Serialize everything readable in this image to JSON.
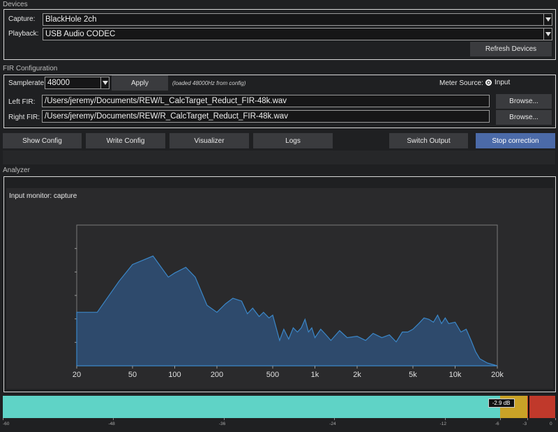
{
  "devices": {
    "title": "Devices",
    "capture_label": "Capture:",
    "capture_value": "BlackHole 2ch",
    "playback_label": "Playback:",
    "playback_value": "USB Audio CODEC",
    "refresh_label": "Refresh Devices"
  },
  "fir": {
    "title": "FIR Configuration",
    "samplerate_label": "Samplerate:",
    "samplerate_value": "48000",
    "apply_label": "Apply",
    "loaded_hint": "(loaded 48000Hz from config)",
    "meter_source_label": "Meter Source:",
    "meter_source_option": "Input",
    "left_label": "Left FIR:",
    "left_path": "/Users/jeremy/Documents/REW/L_CalcTarget_Reduct_FIR-48k.wav",
    "right_label": "Right FIR:",
    "right_path": "/Users/jeremy/Documents/REW/R_CalcTarget_Reduct_FIR-48k.wav",
    "browse_label": "Browse..."
  },
  "toolbar": {
    "show_config": "Show Config",
    "write_config": "Write Config",
    "visualizer": "Visualizer",
    "logs": "Logs",
    "switch_output": "Switch Output",
    "stop_correction": "Stop correction"
  },
  "analyzer": {
    "title": "Analyzer",
    "monitor_title": "Input monitor: capture"
  },
  "colors": {
    "accent": "#4b6aa8",
    "spectrum_fill": "#2e4a6c",
    "spectrum_line": "#3b87c8",
    "meter_fill": "#5fd3c6",
    "meter_warn": "#c9a227",
    "meter_clip": "#c0392b"
  },
  "chart_data": {
    "type": "area",
    "title": "",
    "xlabel": "",
    "ylabel": "",
    "x_scale": "log",
    "xlim": [
      20,
      20000
    ],
    "ylim": [
      0,
      1
    ],
    "x_ticks": [
      20,
      50,
      100,
      200,
      500,
      1000,
      2000,
      5000,
      10000,
      20000
    ],
    "x_tick_labels": [
      "20",
      "50",
      "100",
      "200",
      "500",
      "1k",
      "2k",
      "5k",
      "10k",
      "20k"
    ],
    "grid": false,
    "series": [
      {
        "x": [
          20,
          28,
          40,
          50,
          70,
          90,
          100,
          120,
          140,
          170,
          200,
          230,
          260,
          300,
          330,
          360,
          400,
          430,
          470,
          500,
          560,
          600,
          650,
          700,
          750,
          800,
          850,
          900,
          950,
          1000,
          1100,
          1200,
          1300,
          1500,
          1700,
          2000,
          2300,
          2600,
          3000,
          3400,
          3800,
          4200,
          4600,
          5000,
          5500,
          6000,
          6500,
          7000,
          7500,
          8000,
          8500,
          9000,
          10000,
          11000,
          12000,
          13000,
          14000,
          15000,
          17000,
          20000
        ],
        "values": [
          0.38,
          0.38,
          0.6,
          0.72,
          0.78,
          0.63,
          0.66,
          0.7,
          0.63,
          0.43,
          0.38,
          0.44,
          0.48,
          0.46,
          0.37,
          0.41,
          0.35,
          0.38,
          0.34,
          0.36,
          0.18,
          0.26,
          0.19,
          0.27,
          0.24,
          0.27,
          0.33,
          0.24,
          0.27,
          0.2,
          0.26,
          0.22,
          0.18,
          0.25,
          0.2,
          0.21,
          0.18,
          0.23,
          0.2,
          0.22,
          0.17,
          0.24,
          0.24,
          0.26,
          0.3,
          0.34,
          0.33,
          0.31,
          0.36,
          0.3,
          0.34,
          0.3,
          0.31,
          0.24,
          0.26,
          0.18,
          0.1,
          0.05,
          0.02,
          0.0
        ]
      }
    ]
  },
  "meter": {
    "value_label": "-2.9 dB",
    "level_db": -2.9,
    "scale_min_db": -60,
    "scale_max_db": 0,
    "ticks": [
      {
        "db": -60,
        "label": "-60"
      },
      {
        "db": -48,
        "label": "-48"
      },
      {
        "db": -36,
        "label": "-36"
      },
      {
        "db": -24,
        "label": "-24"
      },
      {
        "db": -12,
        "label": "-12"
      },
      {
        "db": -6,
        "label": "-6"
      },
      {
        "db": -3,
        "label": "-3"
      },
      {
        "db": 0,
        "label": "0"
      }
    ]
  }
}
